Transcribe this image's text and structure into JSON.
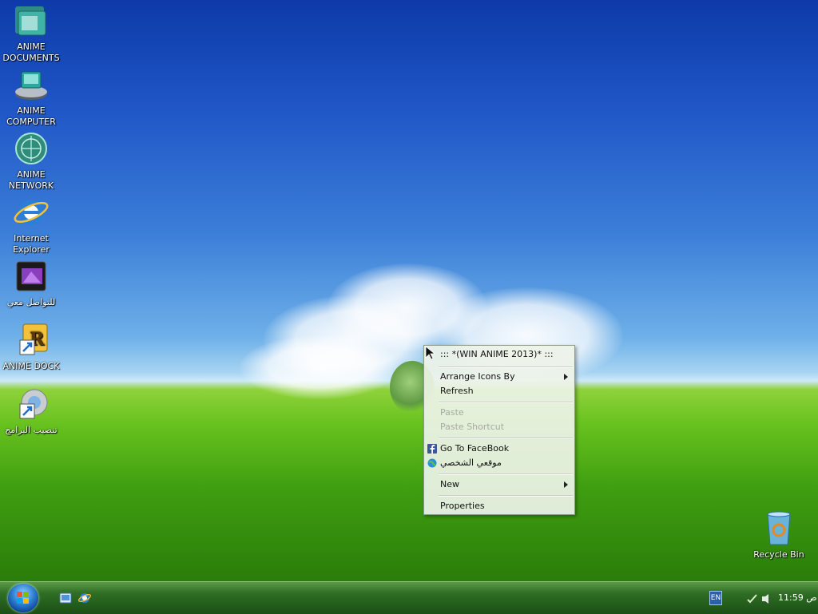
{
  "desktop": {
    "icons": [
      {
        "label1": "ANIME",
        "label2": "DOCUMENTS"
      },
      {
        "label1": "ANIME",
        "label2": "COMPUTER"
      },
      {
        "label1": "ANIME",
        "label2": "NETWORK"
      },
      {
        "label1": "Internet",
        "label2": "Explorer"
      },
      {
        "label1": "للتواصل معي",
        "label2": ""
      },
      {
        "label1": "ANIME DOCK",
        "label2": ""
      },
      {
        "label1": "تنصيب البرامج",
        "label2": ""
      }
    ],
    "recycle_bin": "Recycle Bin"
  },
  "context_menu": {
    "header": "::: *(WIN ANIME 2013)* :::",
    "arrange_icons": "Arrange Icons By",
    "refresh": "Refresh",
    "paste": "Paste",
    "paste_shortcut": "Paste Shortcut",
    "facebook": "Go To FaceBook",
    "my_site": "موقعي الشخصي",
    "new": "New",
    "properties": "Properties"
  },
  "taskbar": {
    "language": "EN",
    "clock": "ص 11:59"
  },
  "colors": {
    "taskbar": "#2f6e24",
    "menu_bg": "#eef3e8",
    "sky": "#1f55c6",
    "grass": "#67c21e"
  }
}
